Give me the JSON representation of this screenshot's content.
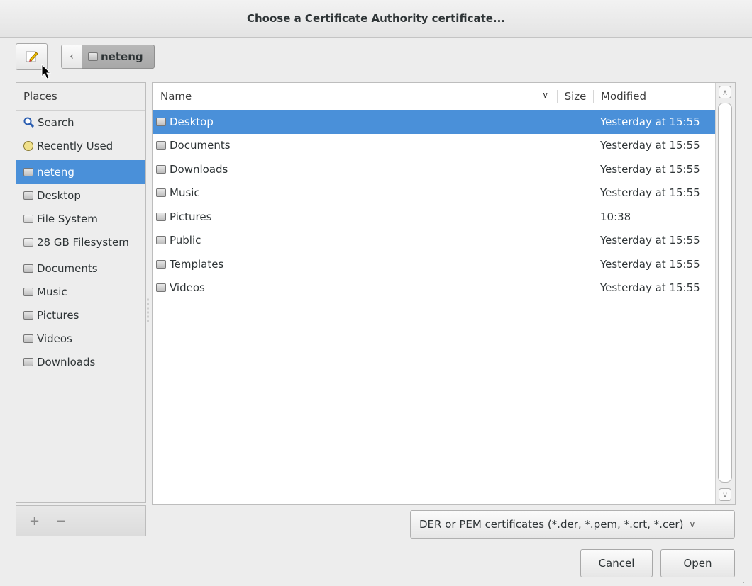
{
  "window": {
    "title": "Choose a Certificate Authority certificate..."
  },
  "toolbar": {
    "back_label": "‹",
    "path_label": "neteng"
  },
  "places": {
    "header": "Places",
    "items": [
      {
        "label": "Search",
        "icon": "search-icon"
      },
      {
        "label": "Recently Used",
        "icon": "recent-icon"
      },
      {
        "label": "neteng",
        "icon": "home-folder-icon",
        "selected": true
      },
      {
        "label": "Desktop",
        "icon": "desktop-folder-icon"
      },
      {
        "label": "File System",
        "icon": "drive-icon"
      },
      {
        "label": "28 GB Filesystem",
        "icon": "drive-icon"
      },
      {
        "label": "Documents",
        "icon": "documents-folder-icon"
      },
      {
        "label": "Music",
        "icon": "music-folder-icon"
      },
      {
        "label": "Pictures",
        "icon": "pictures-folder-icon"
      },
      {
        "label": "Videos",
        "icon": "videos-folder-icon"
      },
      {
        "label": "Downloads",
        "icon": "downloads-folder-icon"
      }
    ],
    "add_label": "+",
    "remove_label": "−"
  },
  "files": {
    "columns": {
      "name": "Name",
      "size": "Size",
      "modified": "Modified"
    },
    "rows": [
      {
        "name": "Desktop",
        "modified": "Yesterday at 15:55",
        "selected": true
      },
      {
        "name": "Documents",
        "modified": "Yesterday at 15:55"
      },
      {
        "name": "Downloads",
        "modified": "Yesterday at 15:55"
      },
      {
        "name": "Music",
        "modified": "Yesterday at 15:55"
      },
      {
        "name": "Pictures",
        "modified": "10:38"
      },
      {
        "name": "Public",
        "modified": "Yesterday at 15:55"
      },
      {
        "name": "Templates",
        "modified": "Yesterday at 15:55"
      },
      {
        "name": "Videos",
        "modified": "Yesterday at 15:55"
      }
    ]
  },
  "filter": {
    "label": "DER or PEM certificates (*.der, *.pem, *.crt, *.cer)"
  },
  "buttons": {
    "cancel": "Cancel",
    "open": "Open"
  },
  "colors": {
    "selection": "#4a90d9",
    "background": "#ededed"
  }
}
